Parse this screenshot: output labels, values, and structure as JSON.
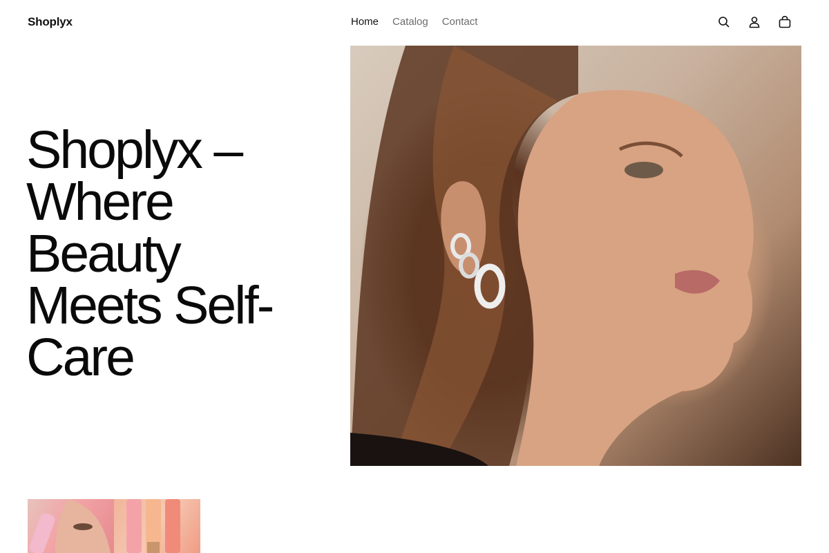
{
  "header": {
    "logo": "Shoplyx",
    "nav": [
      {
        "label": "Home",
        "active": true
      },
      {
        "label": "Catalog",
        "active": false
      },
      {
        "label": "Contact",
        "active": false
      }
    ],
    "icons": [
      "search-icon",
      "account-icon",
      "cart-icon"
    ]
  },
  "hero": {
    "title": "Shoplyx – Where Beauty Meets Self-Care",
    "image_description_icon": "model-photo"
  },
  "thumbnails": [
    {
      "name": "blush-product-thumbnail"
    },
    {
      "name": "lip-gloss-product-thumbnail"
    }
  ],
  "colors": {
    "text": "#111111",
    "nav_inactive": "#6b6b6b",
    "background": "#ffffff"
  }
}
